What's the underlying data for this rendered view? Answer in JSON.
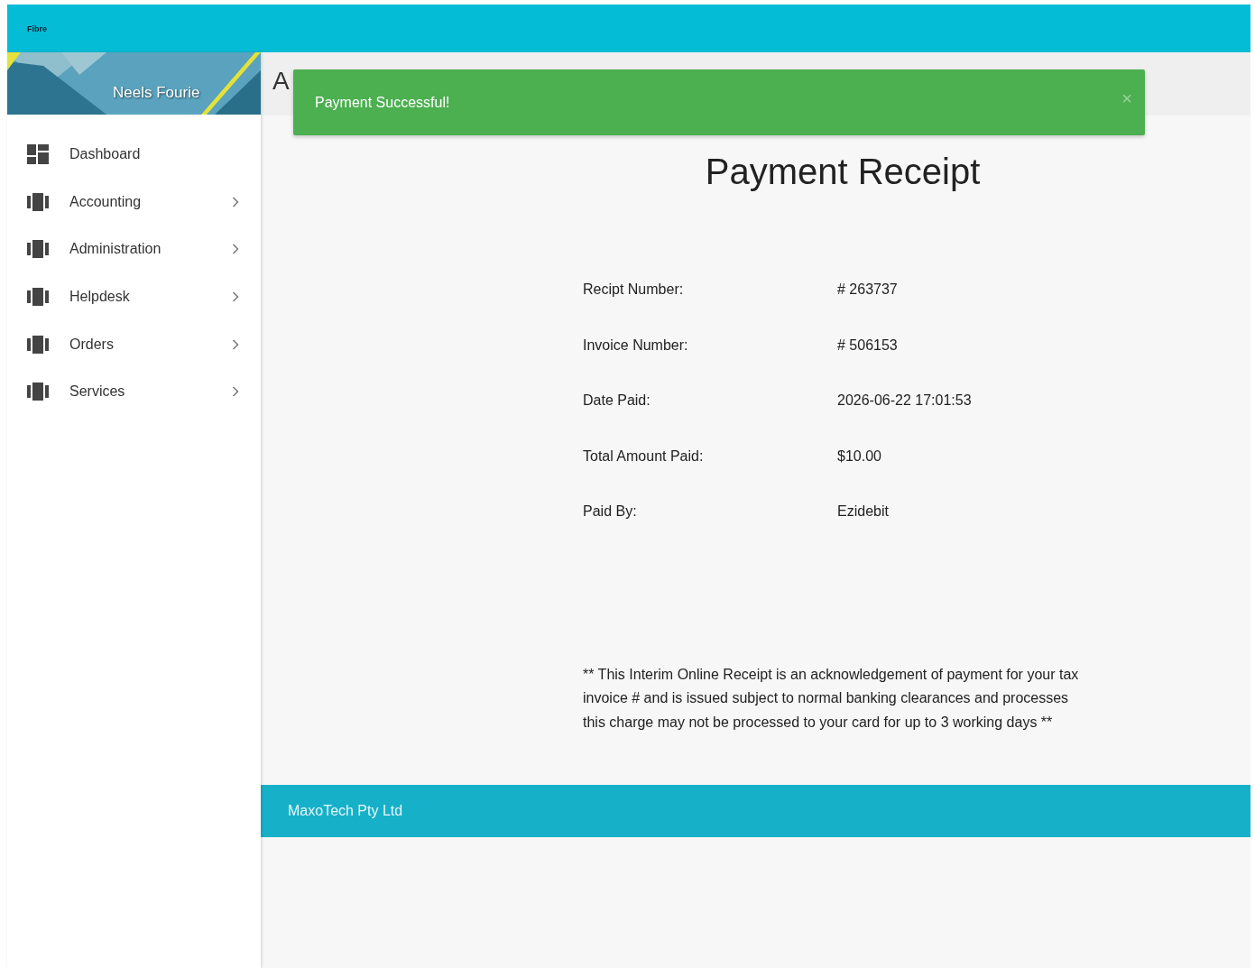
{
  "header": {
    "logo_text": "Fibre"
  },
  "sidebar": {
    "user_name": "Neels Fourie",
    "items": [
      {
        "label": "Dashboard",
        "kind": "dashboard",
        "expandable": false
      },
      {
        "label": "Accounting",
        "kind": "module",
        "expandable": true
      },
      {
        "label": "Administration",
        "kind": "module",
        "expandable": true
      },
      {
        "label": "Helpdesk",
        "kind": "module",
        "expandable": true
      },
      {
        "label": "Orders",
        "kind": "module",
        "expandable": true
      },
      {
        "label": "Services",
        "kind": "module",
        "expandable": true
      }
    ]
  },
  "page_title": "A",
  "alert": {
    "message": "Payment Successful!",
    "close": "×"
  },
  "receipt": {
    "title": "Payment Receipt",
    "rows": [
      {
        "label": "Recipt Number:",
        "value": "# 263737"
      },
      {
        "label": "Invoice Number:",
        "value": "# 506153"
      },
      {
        "label": "Date Paid:",
        "value": "2026-06-22 17:01:53"
      },
      {
        "label": "Total Amount Paid:",
        "value": "$10.00"
      },
      {
        "label": "Paid By:",
        "value": "Ezidebit"
      }
    ],
    "note": "** This Interim Online Receipt is an acknowledgement of payment for your tax invoice # and is issued subject to normal banking clearances and processes this charge may not be processed to your card for up to 3 working days **"
  },
  "footer": {
    "text": "MaxoTech Pty Ltd"
  }
}
